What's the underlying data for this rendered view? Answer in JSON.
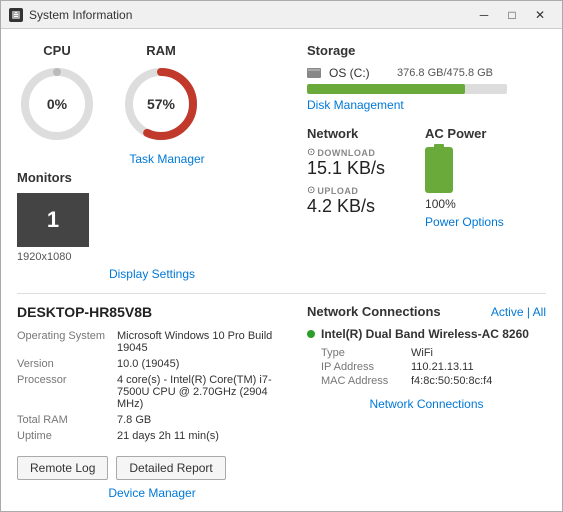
{
  "window": {
    "title": "System Information",
    "icon": "info-icon",
    "controls": {
      "minimize": "─",
      "maximize": "□",
      "close": "✕"
    }
  },
  "cpu": {
    "label": "CPU",
    "value": "0%",
    "percent": 0,
    "color_track": "#ddd",
    "color_fill": "#bbb"
  },
  "ram": {
    "label": "RAM",
    "value": "57%",
    "percent": 57,
    "color_track": "#ddd",
    "color_fill": "#c0392b"
  },
  "task_manager_link": "Task Manager",
  "monitors": {
    "title": "Monitors",
    "count": "1",
    "resolution": "1920x1080",
    "link": "Display Settings"
  },
  "storage": {
    "title": "Storage",
    "drives": [
      {
        "name": "OS (C:)",
        "size": "376.8 GB/475.8 GB",
        "fill_pct": 79
      }
    ],
    "link": "Disk Management"
  },
  "network": {
    "title": "Network",
    "download": {
      "label": "DOWNLOAD",
      "value": "15.1 KB/s"
    },
    "upload": {
      "label": "UPLOAD",
      "value": "4.2 KB/s"
    }
  },
  "ac_power": {
    "title": "AC Power",
    "percent": "100%",
    "link": "Power Options"
  },
  "system": {
    "hostname": "DESKTOP-HR85V8B",
    "rows": [
      {
        "label": "Operating System",
        "value": "Microsoft Windows 10 Pro Build 19045"
      },
      {
        "label": "Version",
        "value": "10.0 (19045)"
      },
      {
        "label": "Processor",
        "value": "4 core(s) - Intel(R) Core(TM) i7-7500U CPU @ 2.70GHz (2904 MHz)"
      },
      {
        "label": "Total RAM",
        "value": "7.8 GB"
      },
      {
        "label": "Uptime",
        "value": "21 days 2h 11 min(s)"
      }
    ],
    "link": "Device Manager"
  },
  "buttons": {
    "remote_log": "Remote Log",
    "detailed_report": "Detailed Report"
  },
  "network_connections": {
    "title": "Network Connections",
    "filter_active": "Active",
    "filter_all": "All",
    "adapter": {
      "name": "Intel(R) Dual Band Wireless-AC 8260",
      "type_label": "Type",
      "type_value": "WiFi",
      "ip_label": "IP Address",
      "ip_value": "110.21.13.11",
      "mac_label": "MAC Address",
      "mac_value": "f4:8c:50:50:8c:f4"
    },
    "link": "Network Connections"
  }
}
